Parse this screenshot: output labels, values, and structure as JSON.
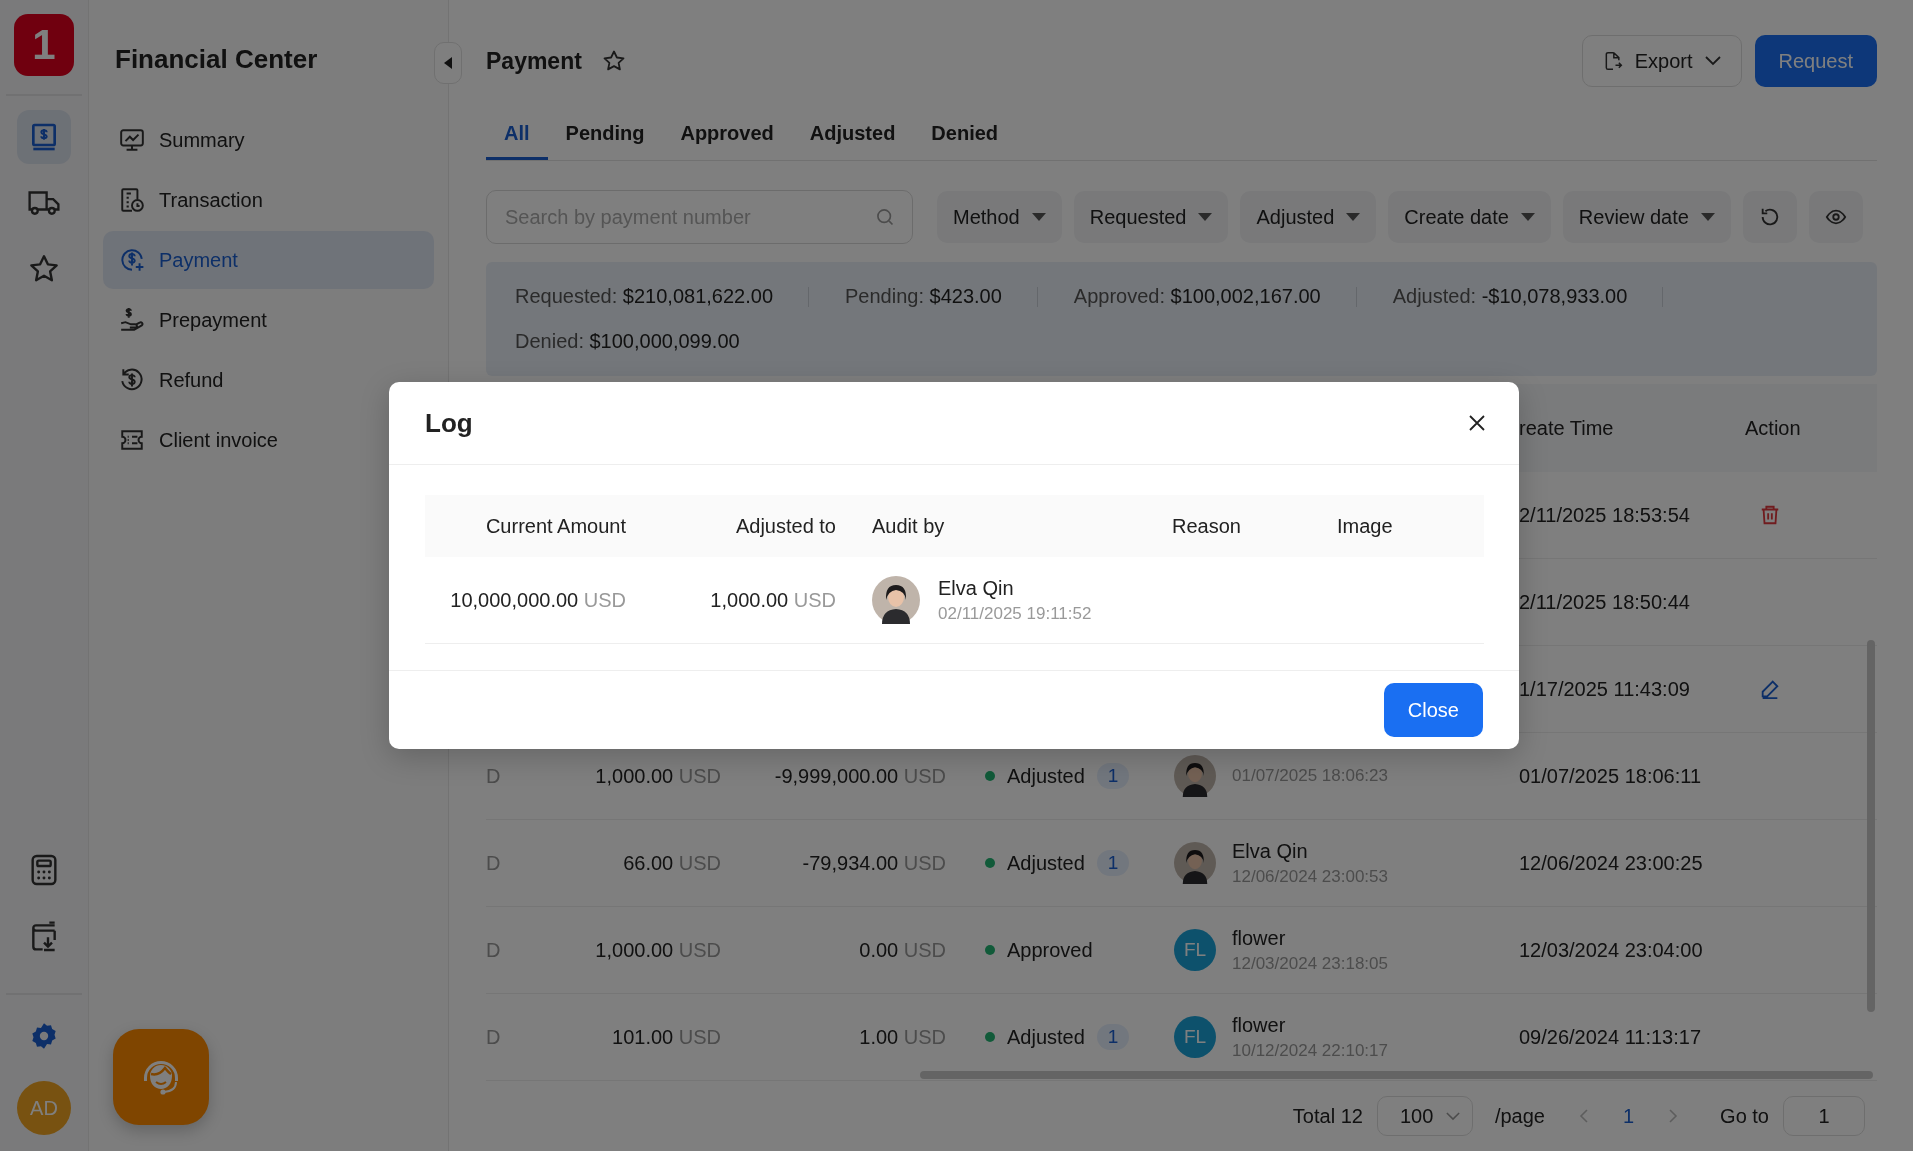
{
  "rail": {
    "logo": "1",
    "items": [
      {
        "kind": "finance",
        "selected": true
      },
      {
        "kind": "truck",
        "selected": false
      },
      {
        "kind": "star",
        "selected": false
      }
    ],
    "tools": [
      {
        "kind": "calculator"
      },
      {
        "kind": "download"
      },
      {
        "kind": "settings"
      }
    ],
    "user": "AD"
  },
  "sidebar": {
    "title": "Financial Center",
    "items": [
      {
        "kind": "summary",
        "label": "Summary",
        "selected": false
      },
      {
        "kind": "transaction",
        "label": "Transaction",
        "selected": false
      },
      {
        "kind": "payment",
        "label": "Payment",
        "selected": true
      },
      {
        "kind": "prepayment",
        "label": "Prepayment",
        "selected": false
      },
      {
        "kind": "refund",
        "label": "Refund",
        "selected": false
      },
      {
        "kind": "invoice",
        "label": "Client invoice",
        "selected": false
      }
    ]
  },
  "page": {
    "title": "Payment",
    "export": "Export",
    "request": "Request"
  },
  "tabs": [
    {
      "label": "All",
      "selected": true
    },
    {
      "label": "Pending",
      "selected": false
    },
    {
      "label": "Approved",
      "selected": false
    },
    {
      "label": "Adjusted",
      "selected": false
    },
    {
      "label": "Denied",
      "selected": false
    }
  ],
  "search": {
    "placeholder": "Search by payment number"
  },
  "filters": [
    "Method",
    "Requested",
    "Adjusted",
    "Create date",
    "Review date"
  ],
  "summary": [
    {
      "label": "Requested:",
      "value": "$210,081,622.00"
    },
    {
      "label": "Pending:",
      "value": "$423.00"
    },
    {
      "label": "Approved:",
      "value": "$100,002,167.00"
    },
    {
      "label": "Adjusted:",
      "value": "-$10,078,933.00"
    },
    {
      "label": "Denied:",
      "value": "$100,000,099.00"
    }
  ],
  "table": {
    "columns": [
      "reate Time",
      "Action"
    ],
    "rows": [
      {
        "create_time": "2/11/2025 18:53:54",
        "action": {
          "kind": "delete"
        }
      },
      {
        "create_time": "2/11/2025 18:50:44"
      },
      {
        "create_time": "1/17/2025 11:43:09",
        "action": {
          "kind": "edit"
        }
      },
      {
        "column_1": "D",
        "requested": "1,000.00",
        "requested_currency": "USD",
        "adjusted": "-9,999,000.00",
        "adjusted_currency": "USD",
        "status": "Adjusted",
        "count": "1",
        "auditor": {
          "kind": "photo",
          "time": "01/07/2025 18:06:23"
        },
        "create_time": "01/07/2025 18:06:11"
      },
      {
        "column_1": "D",
        "requested": "66.00",
        "requested_currency": "USD",
        "adjusted": "-79,934.00",
        "adjusted_currency": "USD",
        "status": "Adjusted",
        "count": "1",
        "auditor": {
          "kind": "photo",
          "name": "Elva Qin",
          "time": "12/06/2024 23:00:53"
        },
        "create_time": "12/06/2024 23:00:25"
      },
      {
        "column_1": "D",
        "requested": "1,000.00",
        "requested_currency": "USD",
        "adjusted": "0.00",
        "adjusted_currency": "USD",
        "status": "Approved",
        "auditor": {
          "kind": "initials",
          "initials": "FL",
          "name": "flower",
          "time": "12/03/2024 23:18:05"
        },
        "create_time": "12/03/2024 23:04:00"
      },
      {
        "column_1": "D",
        "requested": "101.00",
        "requested_currency": "USD",
        "adjusted": "1.00",
        "adjusted_currency": "USD",
        "status": "Adjusted",
        "count": "1",
        "auditor": {
          "kind": "initials",
          "initials": "FL",
          "name": "flower",
          "time": "10/12/2024 22:10:17"
        },
        "create_time": "09/26/2024 11:13:17"
      }
    ]
  },
  "pagination": {
    "total": "Total 12",
    "page_size": "100",
    "per_page": "/page",
    "current_page": "1",
    "goto_label": "Go to",
    "goto_value": "1"
  },
  "modal": {
    "title": "Log",
    "columns": [
      "Current Amount",
      "Adjusted to",
      "Audit by",
      "Reason",
      "Image"
    ],
    "rows": [
      {
        "current_amount": "10,000,000.00",
        "current_currency": "USD",
        "adjusted_to": "1,000.00",
        "adjusted_currency": "USD",
        "auditor": {
          "kind": "photo",
          "name": "Elva Qin",
          "time": "02/11/2025 19:11:52"
        }
      }
    ],
    "close": "Close"
  }
}
